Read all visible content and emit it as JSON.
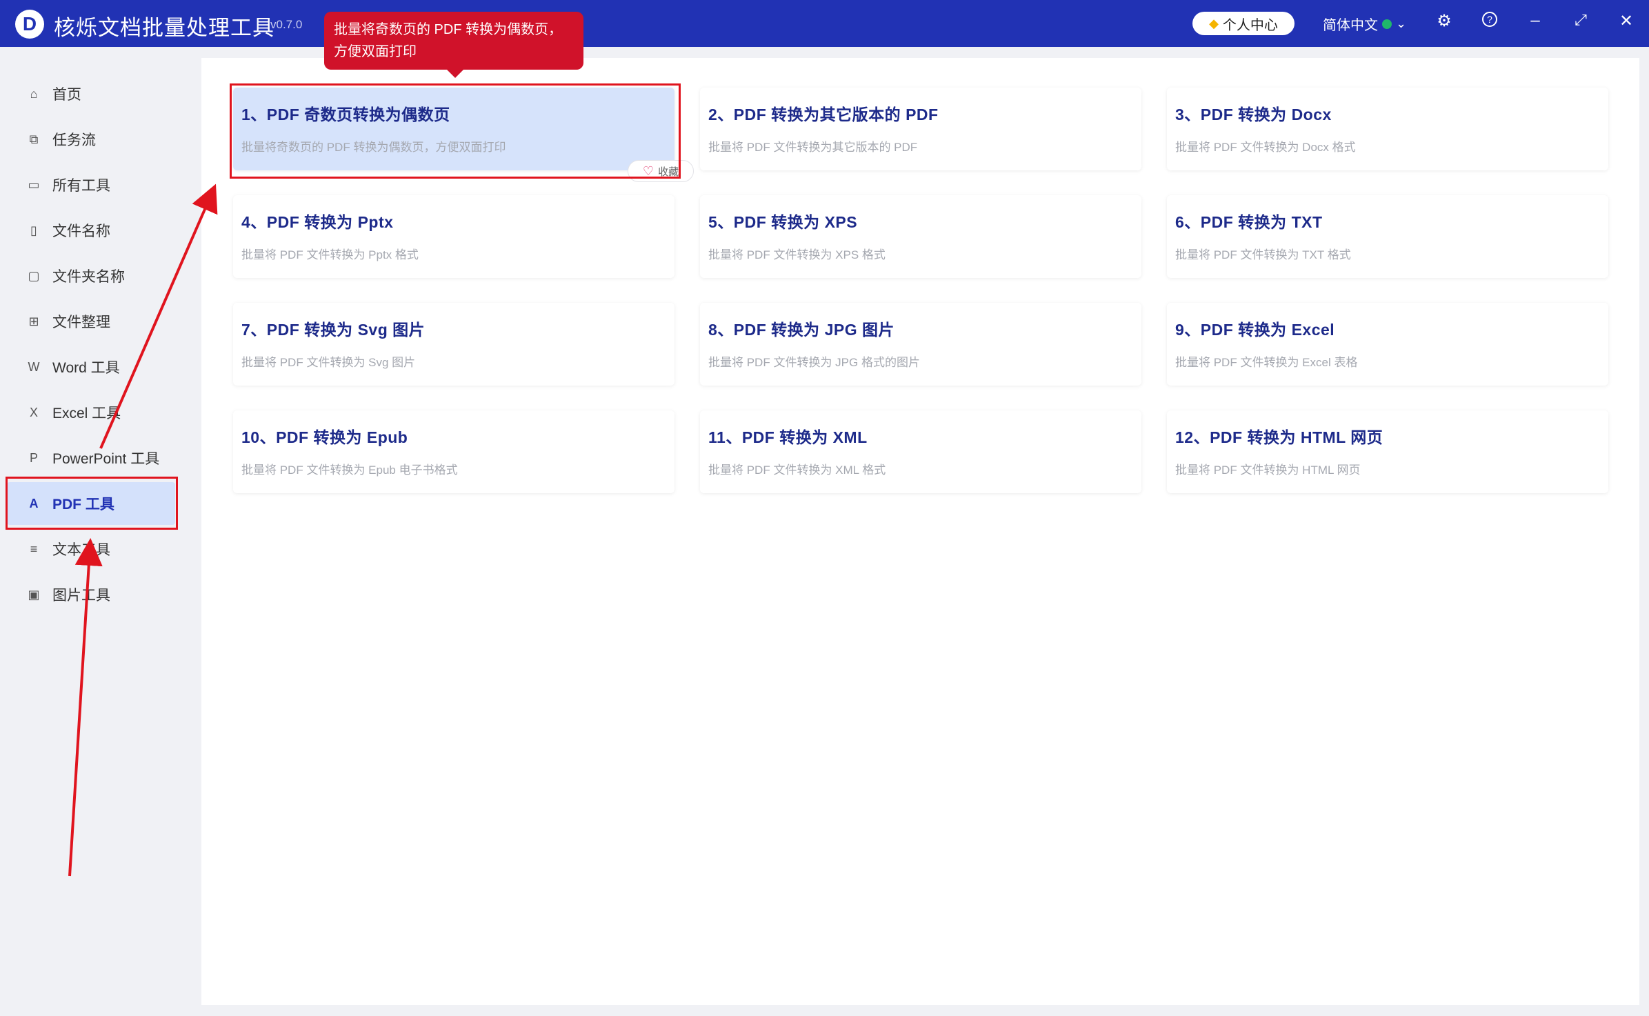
{
  "app": {
    "title": "核烁文档批量处理工具",
    "version": "v0.7.0",
    "logo_letter": "D"
  },
  "tooltip": {
    "text": "批量将奇数页的 PDF 转换为偶数页，方便双面打印"
  },
  "titlebar": {
    "user_center": "个人中心",
    "language": "简体中文",
    "icons": [
      "chevron-down-icon",
      "gear-icon",
      "help-icon",
      "minimize-icon",
      "maximize-icon",
      "close-icon"
    ]
  },
  "sidebar": {
    "items": [
      {
        "label": "首页",
        "icon": "home-icon",
        "active": false
      },
      {
        "label": "任务流",
        "icon": "workflow-icon",
        "active": false
      },
      {
        "label": "所有工具",
        "icon": "monitor-icon",
        "active": false
      },
      {
        "label": "文件名称",
        "icon": "file-icon",
        "active": false
      },
      {
        "label": "文件夹名称",
        "icon": "folder-icon",
        "active": false
      },
      {
        "label": "文件整理",
        "icon": "organize-icon",
        "active": false
      },
      {
        "label": "Word 工具",
        "icon": "word-icon",
        "active": false
      },
      {
        "label": "Excel 工具",
        "icon": "excel-icon",
        "active": false
      },
      {
        "label": "PowerPoint 工具",
        "icon": "powerpoint-icon",
        "active": false
      },
      {
        "label": "PDF 工具",
        "icon": "pdf-icon",
        "active": true
      },
      {
        "label": "文本工具",
        "icon": "text-file-icon",
        "active": false
      },
      {
        "label": "图片工具",
        "icon": "image-icon",
        "active": false
      }
    ]
  },
  "tools": [
    {
      "title": "1、PDF 奇数页转换为偶数页",
      "desc": "批量将奇数页的 PDF 转换为偶数页，方便双面打印",
      "active": true
    },
    {
      "title": "2、PDF 转换为其它版本的 PDF",
      "desc": "批量将 PDF 文件转换为其它版本的 PDF"
    },
    {
      "title": "3、PDF 转换为 Docx",
      "desc": "批量将 PDF 文件转换为 Docx 格式"
    },
    {
      "title": "4、PDF 转换为 Pptx",
      "desc": "批量将 PDF 文件转换为 Pptx 格式"
    },
    {
      "title": "5、PDF 转换为 XPS",
      "desc": "批量将 PDF 文件转换为 XPS 格式"
    },
    {
      "title": "6、PDF 转换为 TXT",
      "desc": "批量将 PDF 文件转换为 TXT 格式"
    },
    {
      "title": "7、PDF 转换为 Svg 图片",
      "desc": "批量将 PDF 文件转换为 Svg 图片"
    },
    {
      "title": "8、PDF 转换为 JPG 图片",
      "desc": "批量将 PDF 文件转换为 JPG 格式的图片"
    },
    {
      "title": "9、PDF 转换为 Excel",
      "desc": "批量将 PDF 文件转换为 Excel 表格"
    },
    {
      "title": "10、PDF 转换为 Epub",
      "desc": "批量将 PDF 文件转换为 Epub 电子书格式"
    },
    {
      "title": "11、PDF 转换为 XML",
      "desc": "批量将 PDF 文件转换为 XML 格式"
    },
    {
      "title": "12、PDF 转换为 HTML 网页",
      "desc": "批量将 PDF 文件转换为 HTML 网页"
    }
  ],
  "favorite": {
    "label": "收藏"
  },
  "colors": {
    "titlebar": "#2132b4",
    "active_bg": "#d4e1fb",
    "annotation": "#e0141e",
    "tooltip": "#d0122a"
  }
}
